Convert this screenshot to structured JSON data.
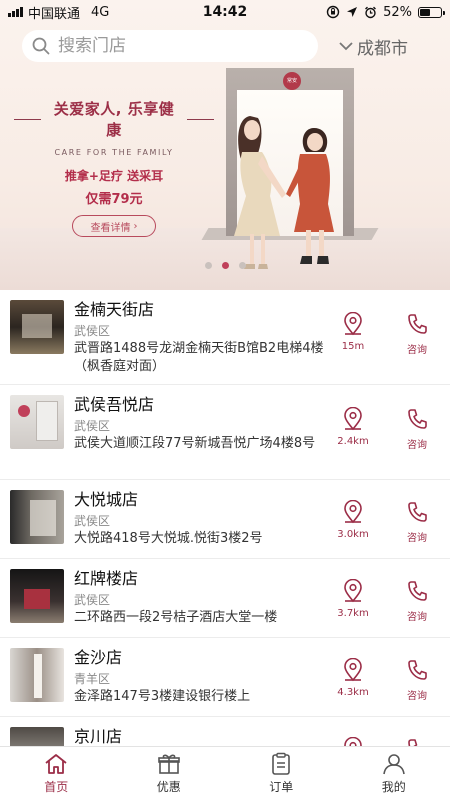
{
  "status_bar": {
    "carrier": "中国联通",
    "network": "4G",
    "time": "14:42",
    "battery": "52%"
  },
  "header": {
    "search_placeholder": "搜索门店",
    "city": "成都市"
  },
  "banner": {
    "headline": "关爱家人, 乐享健康",
    "subtitle": "CARE FOR THE FAMILY",
    "offer": "推拿+足疗 送采耳",
    "price": "仅需79元",
    "button_label": "查看详情",
    "logo_text": "常安",
    "active_slide": 2,
    "slide_count": 3
  },
  "stores": [
    {
      "name": "金楠天街店",
      "district": "武侯区",
      "address": "武晋路1488号龙湖金楠天街B馆B2电梯4楼（枫香庭对面）",
      "distance": "15m",
      "consult": "咨询"
    },
    {
      "name": "武侯吾悦店",
      "district": "武侯区",
      "address": "武侯大道顺江段77号新城吾悦广场4楼8号",
      "distance": "2.4km",
      "consult": "咨询"
    },
    {
      "name": "大悦城店",
      "district": "武侯区",
      "address": "大悦路418号大悦城.悦街3楼2号",
      "distance": "3.0km",
      "consult": "咨询"
    },
    {
      "name": "红牌楼店",
      "district": "武侯区",
      "address": "二环路西一段2号桔子酒店大堂一楼",
      "distance": "3.7km",
      "consult": "咨询"
    },
    {
      "name": "金沙店",
      "district": "青羊区",
      "address": "金泽路147号3楼建设银行楼上",
      "distance": "4.3km",
      "consult": "咨询"
    },
    {
      "name": "京川店",
      "district": "",
      "address": "",
      "distance": "",
      "consult": ""
    }
  ],
  "tabs": [
    {
      "label": "首页",
      "icon": "home-icon",
      "active": true
    },
    {
      "label": "优惠",
      "icon": "gift-icon",
      "active": false
    },
    {
      "label": "订单",
      "icon": "order-icon",
      "active": false
    },
    {
      "label": "我的",
      "icon": "user-icon",
      "active": false
    }
  ],
  "colors": {
    "accent": "#9b2d47",
    "banner_bg": "#f8ece5"
  }
}
